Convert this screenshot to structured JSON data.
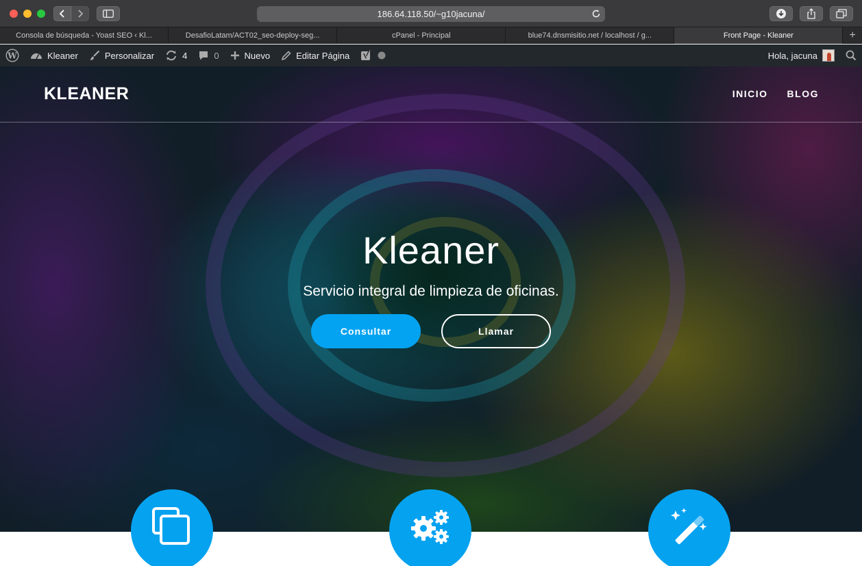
{
  "browser": {
    "url": "186.64.118.50/~g10jacuna/",
    "tabs": [
      {
        "label": "Consola de búsqueda - Yoast SEO ‹ Kl..."
      },
      {
        "label": "DesafioLatam/ACT02_seo-deploy-seg..."
      },
      {
        "label": "cPanel - Principal"
      },
      {
        "label": "blue74.dnsmisitio.net / localhost / g..."
      },
      {
        "label": "Front Page - Kleaner"
      }
    ],
    "add_tab": "+"
  },
  "adminbar": {
    "site_name": "Kleaner",
    "customize": "Personalizar",
    "updates_count": "4",
    "comments_count": "0",
    "new_label": "Nuevo",
    "edit_label": "Editar Página",
    "greeting": "Hola, jacuna"
  },
  "site": {
    "logo": "KLEANER",
    "nav": [
      {
        "label": "INICIO"
      },
      {
        "label": "BLOG"
      }
    ]
  },
  "hero": {
    "title": "Kleaner",
    "subtitle": "Servicio integral de limpieza de oficinas.",
    "primary_button": "Consultar",
    "secondary_button": "Llamar"
  },
  "features": [
    {
      "icon": "copy-icon"
    },
    {
      "icon": "gears-icon"
    },
    {
      "icon": "magic-wand-icon"
    }
  ],
  "colors": {
    "accent": "#04a3f2",
    "adminbar": "#23282d"
  }
}
